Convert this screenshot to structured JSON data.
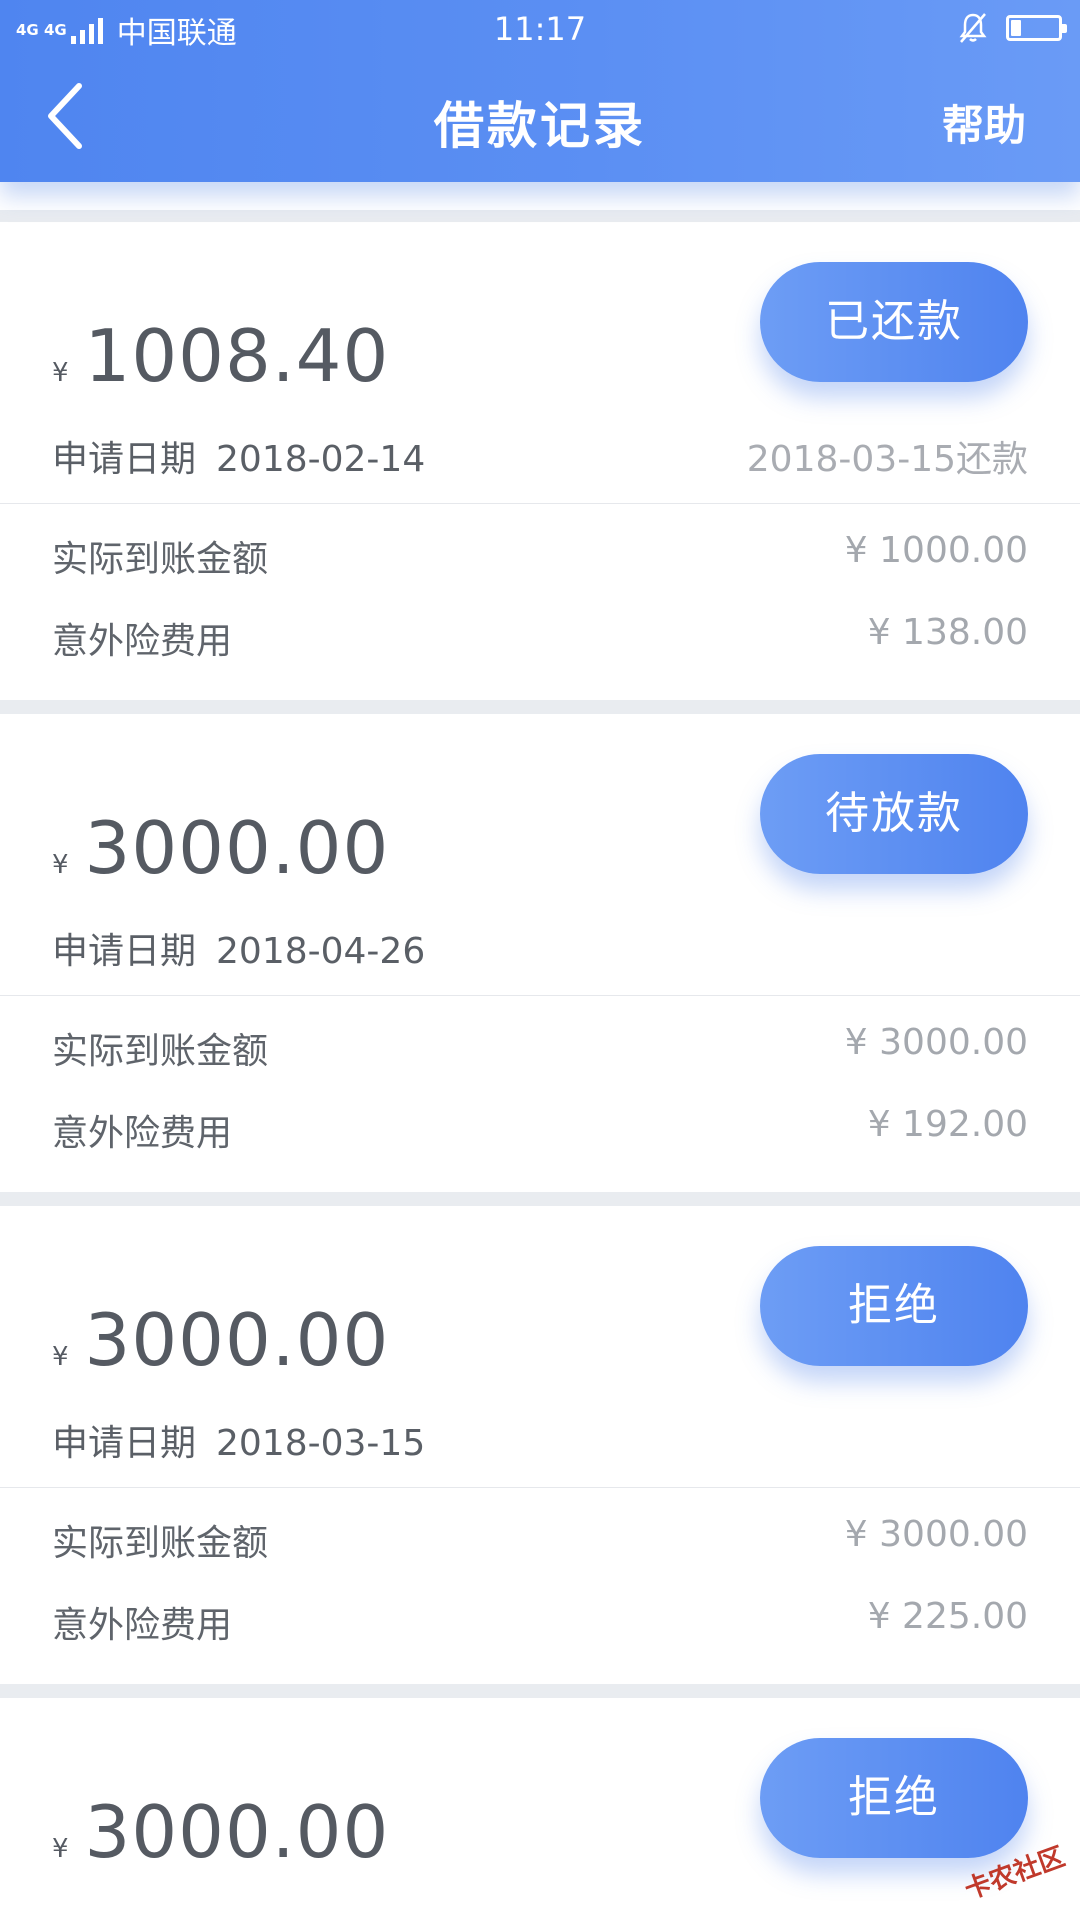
{
  "status_bar": {
    "network": "4G 4G",
    "carrier": "中国联通",
    "time": "11:17"
  },
  "nav": {
    "title": "借款记录",
    "help": "帮助"
  },
  "labels": {
    "apply_date": "申请日期",
    "actual_amount": "实际到账金额",
    "insurance_fee": "意外险费用",
    "currency": "¥"
  },
  "records": [
    {
      "amount": "1008.40",
      "status": "已还款",
      "apply_date": "2018-02-14",
      "repay_note": "2018-03-15还款",
      "actual_amount": "¥ 1000.00",
      "insurance_fee": "¥ 138.00"
    },
    {
      "amount": "3000.00",
      "status": "待放款",
      "apply_date": "2018-04-26",
      "repay_note": "",
      "actual_amount": "¥ 3000.00",
      "insurance_fee": "¥ 192.00"
    },
    {
      "amount": "3000.00",
      "status": "拒绝",
      "apply_date": "2018-03-15",
      "repay_note": "",
      "actual_amount": "¥ 3000.00",
      "insurance_fee": "¥ 225.00"
    },
    {
      "amount": "3000.00",
      "status": "拒绝"
    }
  ],
  "watermark": "卡农社区",
  "colors": {
    "header": "#5b8ff3",
    "pill": "#4f83ef"
  }
}
